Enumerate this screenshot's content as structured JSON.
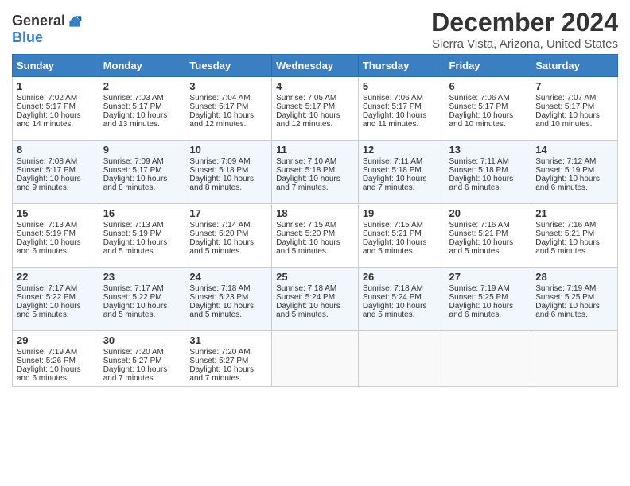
{
  "logo": {
    "general": "General",
    "blue": "Blue"
  },
  "title": "December 2024",
  "subtitle": "Sierra Vista, Arizona, United States",
  "days_header": [
    "Sunday",
    "Monday",
    "Tuesday",
    "Wednesday",
    "Thursday",
    "Friday",
    "Saturday"
  ],
  "weeks": [
    [
      {
        "day": "1",
        "sunrise": "Sunrise: 7:02 AM",
        "sunset": "Sunset: 5:17 PM",
        "daylight": "Daylight: 10 hours and 14 minutes."
      },
      {
        "day": "2",
        "sunrise": "Sunrise: 7:03 AM",
        "sunset": "Sunset: 5:17 PM",
        "daylight": "Daylight: 10 hours and 13 minutes."
      },
      {
        "day": "3",
        "sunrise": "Sunrise: 7:04 AM",
        "sunset": "Sunset: 5:17 PM",
        "daylight": "Daylight: 10 hours and 12 minutes."
      },
      {
        "day": "4",
        "sunrise": "Sunrise: 7:05 AM",
        "sunset": "Sunset: 5:17 PM",
        "daylight": "Daylight: 10 hours and 12 minutes."
      },
      {
        "day": "5",
        "sunrise": "Sunrise: 7:06 AM",
        "sunset": "Sunset: 5:17 PM",
        "daylight": "Daylight: 10 hours and 11 minutes."
      },
      {
        "day": "6",
        "sunrise": "Sunrise: 7:06 AM",
        "sunset": "Sunset: 5:17 PM",
        "daylight": "Daylight: 10 hours and 10 minutes."
      },
      {
        "day": "7",
        "sunrise": "Sunrise: 7:07 AM",
        "sunset": "Sunset: 5:17 PM",
        "daylight": "Daylight: 10 hours and 10 minutes."
      }
    ],
    [
      {
        "day": "8",
        "sunrise": "Sunrise: 7:08 AM",
        "sunset": "Sunset: 5:17 PM",
        "daylight": "Daylight: 10 hours and 9 minutes."
      },
      {
        "day": "9",
        "sunrise": "Sunrise: 7:09 AM",
        "sunset": "Sunset: 5:17 PM",
        "daylight": "Daylight: 10 hours and 8 minutes."
      },
      {
        "day": "10",
        "sunrise": "Sunrise: 7:09 AM",
        "sunset": "Sunset: 5:18 PM",
        "daylight": "Daylight: 10 hours and 8 minutes."
      },
      {
        "day": "11",
        "sunrise": "Sunrise: 7:10 AM",
        "sunset": "Sunset: 5:18 PM",
        "daylight": "Daylight: 10 hours and 7 minutes."
      },
      {
        "day": "12",
        "sunrise": "Sunrise: 7:11 AM",
        "sunset": "Sunset: 5:18 PM",
        "daylight": "Daylight: 10 hours and 7 minutes."
      },
      {
        "day": "13",
        "sunrise": "Sunrise: 7:11 AM",
        "sunset": "Sunset: 5:18 PM",
        "daylight": "Daylight: 10 hours and 6 minutes."
      },
      {
        "day": "14",
        "sunrise": "Sunrise: 7:12 AM",
        "sunset": "Sunset: 5:19 PM",
        "daylight": "Daylight: 10 hours and 6 minutes."
      }
    ],
    [
      {
        "day": "15",
        "sunrise": "Sunrise: 7:13 AM",
        "sunset": "Sunset: 5:19 PM",
        "daylight": "Daylight: 10 hours and 6 minutes."
      },
      {
        "day": "16",
        "sunrise": "Sunrise: 7:13 AM",
        "sunset": "Sunset: 5:19 PM",
        "daylight": "Daylight: 10 hours and 5 minutes."
      },
      {
        "day": "17",
        "sunrise": "Sunrise: 7:14 AM",
        "sunset": "Sunset: 5:20 PM",
        "daylight": "Daylight: 10 hours and 5 minutes."
      },
      {
        "day": "18",
        "sunrise": "Sunrise: 7:15 AM",
        "sunset": "Sunset: 5:20 PM",
        "daylight": "Daylight: 10 hours and 5 minutes."
      },
      {
        "day": "19",
        "sunrise": "Sunrise: 7:15 AM",
        "sunset": "Sunset: 5:21 PM",
        "daylight": "Daylight: 10 hours and 5 minutes."
      },
      {
        "day": "20",
        "sunrise": "Sunrise: 7:16 AM",
        "sunset": "Sunset: 5:21 PM",
        "daylight": "Daylight: 10 hours and 5 minutes."
      },
      {
        "day": "21",
        "sunrise": "Sunrise: 7:16 AM",
        "sunset": "Sunset: 5:21 PM",
        "daylight": "Daylight: 10 hours and 5 minutes."
      }
    ],
    [
      {
        "day": "22",
        "sunrise": "Sunrise: 7:17 AM",
        "sunset": "Sunset: 5:22 PM",
        "daylight": "Daylight: 10 hours and 5 minutes."
      },
      {
        "day": "23",
        "sunrise": "Sunrise: 7:17 AM",
        "sunset": "Sunset: 5:22 PM",
        "daylight": "Daylight: 10 hours and 5 minutes."
      },
      {
        "day": "24",
        "sunrise": "Sunrise: 7:18 AM",
        "sunset": "Sunset: 5:23 PM",
        "daylight": "Daylight: 10 hours and 5 minutes."
      },
      {
        "day": "25",
        "sunrise": "Sunrise: 7:18 AM",
        "sunset": "Sunset: 5:24 PM",
        "daylight": "Daylight: 10 hours and 5 minutes."
      },
      {
        "day": "26",
        "sunrise": "Sunrise: 7:18 AM",
        "sunset": "Sunset: 5:24 PM",
        "daylight": "Daylight: 10 hours and 5 minutes."
      },
      {
        "day": "27",
        "sunrise": "Sunrise: 7:19 AM",
        "sunset": "Sunset: 5:25 PM",
        "daylight": "Daylight: 10 hours and 6 minutes."
      },
      {
        "day": "28",
        "sunrise": "Sunrise: 7:19 AM",
        "sunset": "Sunset: 5:25 PM",
        "daylight": "Daylight: 10 hours and 6 minutes."
      }
    ],
    [
      {
        "day": "29",
        "sunrise": "Sunrise: 7:19 AM",
        "sunset": "Sunset: 5:26 PM",
        "daylight": "Daylight: 10 hours and 6 minutes."
      },
      {
        "day": "30",
        "sunrise": "Sunrise: 7:20 AM",
        "sunset": "Sunset: 5:27 PM",
        "daylight": "Daylight: 10 hours and 7 minutes."
      },
      {
        "day": "31",
        "sunrise": "Sunrise: 7:20 AM",
        "sunset": "Sunset: 5:27 PM",
        "daylight": "Daylight: 10 hours and 7 minutes."
      },
      null,
      null,
      null,
      null
    ]
  ]
}
